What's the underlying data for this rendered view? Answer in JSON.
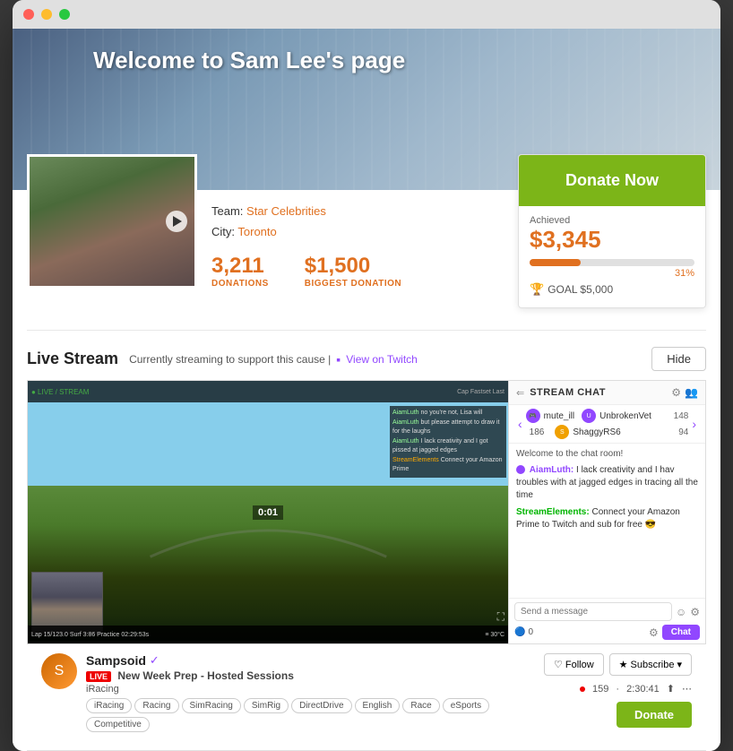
{
  "window": {
    "dots": [
      "red",
      "yellow",
      "green"
    ]
  },
  "hero": {
    "title": "Welcome to Sam Lee's page"
  },
  "profile": {
    "team_label": "Team:",
    "team_name": "Star Celebrities",
    "city_label": "City:",
    "city_name": "Toronto"
  },
  "stats": {
    "donations_count": "3,211",
    "donations_label": "DONATIONS",
    "biggest_donation": "$1,500",
    "biggest_donation_label": "BIGGEST DONATION"
  },
  "donate_card": {
    "button_label": "Donate Now",
    "achieved_label": "Achieved",
    "achieved_amount": "$3,345",
    "progress_pct": "31%",
    "goal_label": "GOAL $5,000",
    "progress_fill_width": "31%"
  },
  "live_stream": {
    "title": "Live Stream",
    "subtitle": "Currently streaming to support this cause  |",
    "twitch_label": "View on Twitch",
    "hide_label": "Hide",
    "timer": "0:01"
  },
  "stream_hud": {
    "top_info": "AiamLuth  no you're not, Lisa will",
    "msg2": "AiamLuth  but please attempt to draw it for the laughs",
    "msg3": "AiamLuth  I lack creativity and I got pissed at jagged edges in tracing all the time",
    "msg4": "StreamElements  Connect your Amazon Prime to Twitch and sub for free"
  },
  "chat": {
    "title": "STREAM CHAT",
    "welcome": "Welcome to the chat room!",
    "viewers": [
      {
        "name": "UnbrokenVet",
        "count": "148",
        "color": "purple"
      },
      {
        "name": "ShaggyRS6",
        "count": "94",
        "color": "yellow"
      }
    ],
    "messages": [
      {
        "user": "AiamLuth",
        "user_color": "purple",
        "text": "I lack creativity and I hav troubles with at jagged edges in tracing all the time"
      },
      {
        "user": "StreamElements",
        "user_color": "green",
        "text": "Connect your Amazon Prime to Twitch and sub for free 😎"
      }
    ],
    "input_placeholder": "Send a message",
    "points": "0",
    "chat_button": "Chat"
  },
  "streamer": {
    "name": "Sampsoid",
    "verified": true,
    "show": "New Week Prep - Hosted Sessions",
    "live": true,
    "category": "iRacing",
    "tags": [
      "iRacing",
      "Racing",
      "SimRacing",
      "SimRig",
      "DirectDrive",
      "English",
      "Race",
      "eSports",
      "Competitive"
    ],
    "viewers": "159",
    "time": "2:30:41",
    "follow_label": "Follow",
    "subscribe_label": "Subscribe",
    "donate_label": "Donate"
  },
  "viewer_badges": {
    "label1": "mute_ill",
    "count1": "186"
  }
}
